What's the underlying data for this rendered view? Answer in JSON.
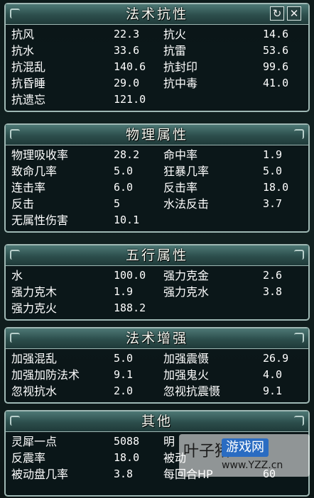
{
  "window_controls": {
    "refresh": "↻",
    "close": "✕"
  },
  "sections": [
    {
      "title": "法术抗性",
      "rows": [
        {
          "k1": "抗风",
          "v1": "22.3",
          "k2": "抗火",
          "v2": "14.6"
        },
        {
          "k1": "抗水",
          "v1": "33.6",
          "k2": "抗雷",
          "v2": "53.6"
        },
        {
          "k1": "抗混乱",
          "v1": "140.6",
          "k2": "抗封印",
          "v2": "99.6"
        },
        {
          "k1": "抗昏睡",
          "v1": "29.0",
          "k2": "抗中毒",
          "v2": "41.0"
        },
        {
          "k1": "抗遗忘",
          "v1": "121.0",
          "k2": "",
          "v2": ""
        }
      ]
    },
    {
      "title": "物理属性",
      "rows": [
        {
          "k1": "物理吸收率",
          "v1": "28.2",
          "k2": "命中率",
          "v2": "1.9"
        },
        {
          "k1": "致命几率",
          "v1": "5.0",
          "k2": "狂暴几率",
          "v2": "5.0"
        },
        {
          "k1": "连击率",
          "v1": "6.0",
          "k2": "反击率",
          "v2": "18.0"
        },
        {
          "k1": "反击",
          "v1": "5",
          "k2": "水法反击",
          "v2": "3.7"
        },
        {
          "k1": "无属性伤害",
          "v1": "10.1",
          "k2": "",
          "v2": ""
        }
      ]
    },
    {
      "title": "五行属性",
      "rows": [
        {
          "k1": "水",
          "v1": "100.0",
          "k2": "强力克金",
          "v2": "2.6"
        },
        {
          "k1": "强力克木",
          "v1": "1.9",
          "k2": "强力克水",
          "v2": "3.8"
        },
        {
          "k1": "强力克火",
          "v1": "188.2",
          "k2": "",
          "v2": ""
        }
      ]
    },
    {
      "title": "法术增强",
      "rows": [
        {
          "k1": "加强混乱",
          "v1": "5.0",
          "k2": "加强震慑",
          "v2": "26.9"
        },
        {
          "k1": "加强加防法术",
          "v1": "9.1",
          "k2": "加强鬼火",
          "v2": "4.0"
        },
        {
          "k1": "忽视抗水",
          "v1": "2.0",
          "k2": "忽视抗震慑",
          "v2": "9.1"
        }
      ]
    },
    {
      "title": "其他",
      "rows": [
        {
          "k1": "灵犀一点",
          "v1": "5088",
          "k2": "明",
          "v2": ""
        },
        {
          "k1": "反震率",
          "v1": "18.0",
          "k2": "被动",
          "v2": ""
        },
        {
          "k1": "被动盘几率",
          "v1": "3.8",
          "k2": "每回合HP",
          "v2": "60"
        }
      ]
    }
  ],
  "watermark": {
    "brand": "叶子猪",
    "badge": "游戏网",
    "url": "www.YZZ.cn"
  }
}
